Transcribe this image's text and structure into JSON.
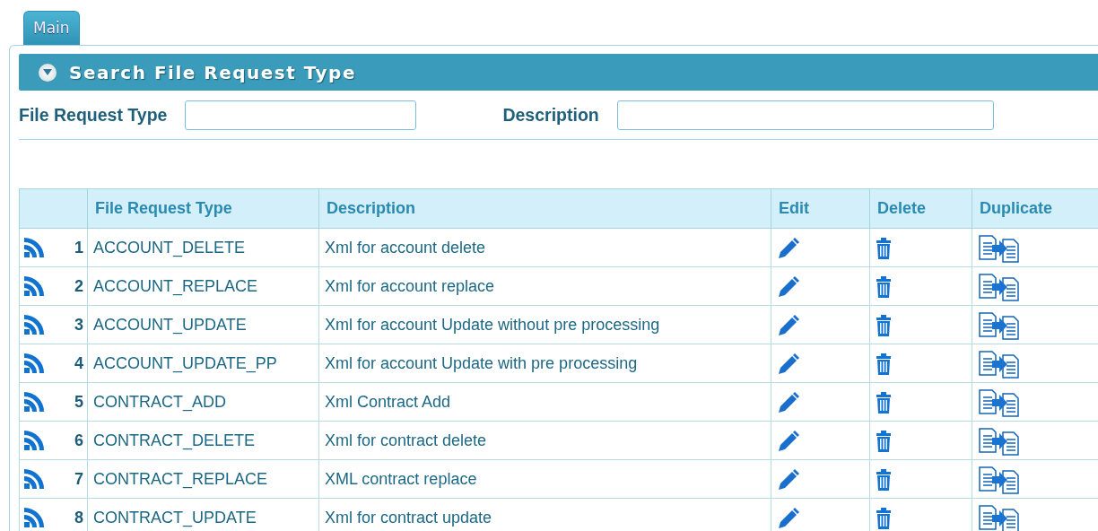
{
  "tabs": [
    {
      "label": "Main",
      "selected": true
    }
  ],
  "panel": {
    "title": "Search File Request Type",
    "expanded": true
  },
  "search": {
    "fields": [
      {
        "label": "File Request Type"
      },
      {
        "label": "Description"
      }
    ]
  },
  "table": {
    "columns": [
      "File Request Type",
      "Description",
      "Edit",
      "Delete",
      "Duplicate"
    ],
    "rows": [
      {
        "number": "1",
        "type": "ACCOUNT_DELETE",
        "description": "Xml for account delete"
      },
      {
        "number": "2",
        "type": "ACCOUNT_REPLACE",
        "description": "Xml for account replace"
      },
      {
        "number": "3",
        "type": "ACCOUNT_UPDATE",
        "description": "Xml for account Update without pre processing"
      },
      {
        "number": "4",
        "type": "ACCOUNT_UPDATE_PP",
        "description": "Xml for account Update with pre processing"
      },
      {
        "number": "5",
        "type": "CONTRACT_ADD",
        "description": "Xml Contract Add"
      },
      {
        "number": "6",
        "type": "CONTRACT_DELETE",
        "description": "Xml for contract delete"
      },
      {
        "number": "7",
        "type": "CONTRACT_REPLACE",
        "description": "XML contract replace"
      },
      {
        "number": "8",
        "type": "CONTRACT_UPDATE",
        "description": "Xml for contract update"
      }
    ]
  }
}
